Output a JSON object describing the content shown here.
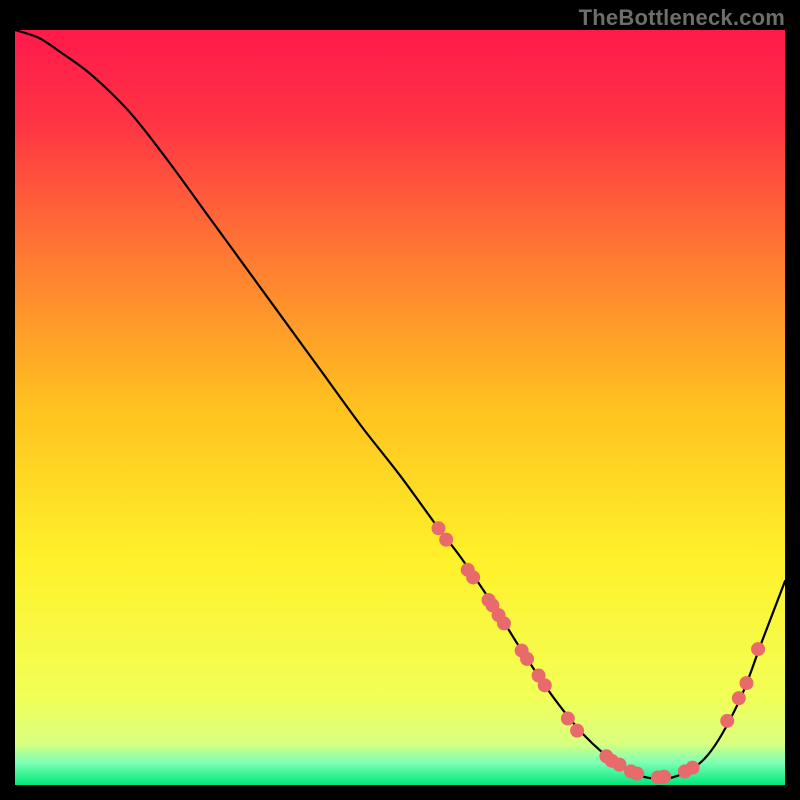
{
  "watermark": "TheBottleneck.com",
  "chart_data": {
    "type": "line",
    "title": "",
    "xlabel": "",
    "ylabel": "",
    "xlim": [
      0,
      100
    ],
    "ylim": [
      0,
      100
    ],
    "background_gradient": {
      "stops": [
        {
          "pos": 0.0,
          "color": "#ff1a4b"
        },
        {
          "pos": 0.12,
          "color": "#ff3344"
        },
        {
          "pos": 0.3,
          "color": "#ff7a33"
        },
        {
          "pos": 0.5,
          "color": "#ffc21f"
        },
        {
          "pos": 0.7,
          "color": "#fff12a"
        },
        {
          "pos": 0.88,
          "color": "#f2ff55"
        },
        {
          "pos": 0.945,
          "color": "#d9ff7f"
        },
        {
          "pos": 0.97,
          "color": "#7fffb5"
        },
        {
          "pos": 1.0,
          "color": "#00e87a"
        }
      ]
    },
    "series": [
      {
        "name": "bottleneck-curve",
        "color": "#000000",
        "x": [
          0,
          3,
          6,
          10,
          15,
          20,
          25,
          30,
          35,
          40,
          45,
          50,
          55,
          58,
          62,
          66,
          70,
          74,
          78,
          82,
          86,
          90,
          94,
          97,
          100
        ],
        "y": [
          100,
          99,
          97,
          94,
          89,
          82.5,
          75.5,
          68.5,
          61.5,
          54.5,
          47.5,
          41,
          34,
          30,
          24,
          17.5,
          11.5,
          6.5,
          3,
          1,
          1.2,
          4,
          11,
          19,
          27
        ]
      }
    ],
    "markers": {
      "name": "highlight-points",
      "color": "#e96a6b",
      "radius_px": 7,
      "points": [
        {
          "x": 55.0,
          "y": 34.0
        },
        {
          "x": 56.0,
          "y": 32.5
        },
        {
          "x": 58.8,
          "y": 28.5
        },
        {
          "x": 59.5,
          "y": 27.5
        },
        {
          "x": 61.5,
          "y": 24.5
        },
        {
          "x": 62.0,
          "y": 23.8
        },
        {
          "x": 62.8,
          "y": 22.5
        },
        {
          "x": 63.5,
          "y": 21.4
        },
        {
          "x": 65.8,
          "y": 17.8
        },
        {
          "x": 66.5,
          "y": 16.7
        },
        {
          "x": 68.0,
          "y": 14.5
        },
        {
          "x": 68.8,
          "y": 13.2
        },
        {
          "x": 71.8,
          "y": 8.8
        },
        {
          "x": 73.0,
          "y": 7.2
        },
        {
          "x": 76.8,
          "y": 3.8
        },
        {
          "x": 77.5,
          "y": 3.2
        },
        {
          "x": 78.5,
          "y": 2.7
        },
        {
          "x": 80.0,
          "y": 1.8
        },
        {
          "x": 80.8,
          "y": 1.5
        },
        {
          "x": 83.5,
          "y": 1.0
        },
        {
          "x": 84.3,
          "y": 1.1
        },
        {
          "x": 87.0,
          "y": 1.8
        },
        {
          "x": 88.0,
          "y": 2.3
        },
        {
          "x": 92.5,
          "y": 8.5
        },
        {
          "x": 94.0,
          "y": 11.5
        },
        {
          "x": 95.0,
          "y": 13.5
        },
        {
          "x": 96.5,
          "y": 18.0
        }
      ]
    }
  }
}
